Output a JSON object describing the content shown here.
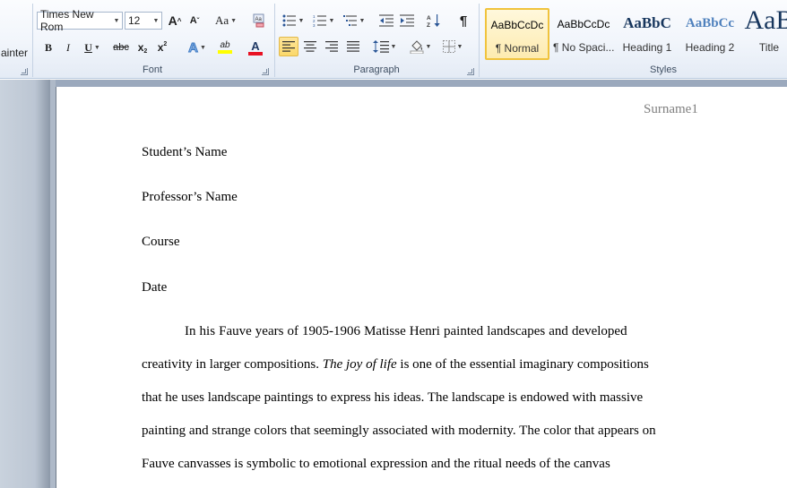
{
  "ribbon": {
    "clipboard": {
      "painter_label": "ainter"
    },
    "font": {
      "group_label": "Font",
      "font_name": "Times New Rom",
      "font_size": "12",
      "grow_label": "A",
      "shrink_label": "A",
      "change_case_label": "Aa",
      "bold_label": "B",
      "italic_label": "I",
      "underline_label": "U",
      "strike_label": "abc",
      "subscript_label": "x",
      "superscript_label": "x",
      "effects_label": "A",
      "highlight_label": "ab",
      "font_color_label": "A",
      "highlight_color": "#ffff00",
      "font_color": "#e81123"
    },
    "paragraph": {
      "group_label": "Paragraph",
      "show_marks_label": "¶"
    },
    "styles": {
      "group_label": "Styles",
      "items": [
        {
          "sample": "AaBbCcDc",
          "name": "¶ Normal"
        },
        {
          "sample": "AaBbCcDc",
          "name": "¶ No Spaci..."
        },
        {
          "sample": "AaBbC",
          "name": "Heading 1"
        },
        {
          "sample": "AaBbCc",
          "name": "Heading 2"
        },
        {
          "sample": "AaB",
          "name": "Title"
        }
      ]
    }
  },
  "document": {
    "header_text": "Surname1",
    "student_name": "Student’s Name",
    "professor_name": "Professor’s Name",
    "course": "Course",
    "date": "Date",
    "body": {
      "line1": "In his Fauve years of 1905-1906 Matisse Henri painted landscapes and developed",
      "line2_before": "creativity in larger compositions. ",
      "line2_italic": "The joy of life",
      "line2_after": " is one of the essential imaginary compositions",
      "line3": "that he uses landscape paintings to express his ideas. The landscape is endowed with massive",
      "line4": "painting and strange colors that seemingly associated with modernity. The color that appears on",
      "line5": "Fauve canvasses is symbolic to emotional expression and the ritual needs of the canvas"
    }
  }
}
